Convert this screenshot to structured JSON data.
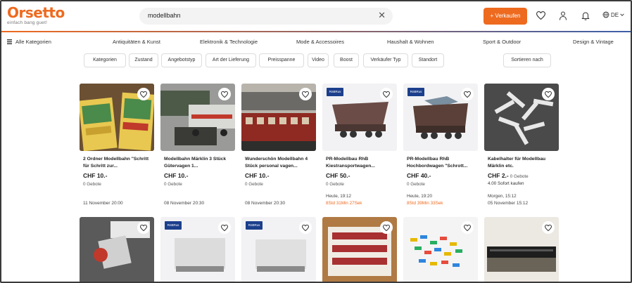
{
  "header": {
    "logo": "Orsetto",
    "tagline": "einfach bang guet!",
    "search_value": "modellbahn",
    "sell_label": "+ Verkaufen",
    "language": "DE"
  },
  "nav": {
    "all_categories": "Alle Kategorien",
    "categories": [
      "Antiquitäten & Kunst",
      "Elektronik & Technologie",
      "Mode & Accessoires",
      "Haushalt & Wohnen",
      "Sport & Outdoor",
      "Design & Vintage"
    ]
  },
  "filters": [
    "Kategorien",
    "Zustand",
    "Angebotstyp",
    "Art der Lieferung",
    "Preisspanne",
    "Video",
    "Boost",
    "Verkäufer Typ",
    "Standort"
  ],
  "sort_label": "Sortieren nach",
  "badge_label": "RnBRus",
  "listings": [
    {
      "title": "2 Ordner Modellbahn \"Schritt für Schritt zur...",
      "price": "CHF 10.-",
      "bids": "0 Gebote",
      "date": "11 November 20:00"
    },
    {
      "title": "Modellbahn Märklin 3 Stück Gütervagen 1...",
      "price": "CHF 10.-",
      "bids": "0 Gebote",
      "date": "08 November 20:30"
    },
    {
      "title": "Wunderschön Modellbahn 4 Stück personal vagen...",
      "price": "CHF 10.-",
      "bids": "0 Gebote",
      "date": "08 November 20:30"
    },
    {
      "title": "PR-Modellbau RhB Kiestransportwagen...",
      "price": "CHF 50.-",
      "bids": "0 Gebote",
      "date": "Heute, 19:12",
      "countdown": "8Std 31Min 27Sek"
    },
    {
      "title": "PR-Modellbau RhB Hochbordwagen \"Schrott...",
      "price": "CHF 40.-",
      "bids": "0 Gebote",
      "date": "Heute, 19:20",
      "countdown": "8Std 39Min 33Sek"
    },
    {
      "title": "Kabelhalter für Modellbau Märklin etc.",
      "price": "CHF 2.-",
      "price_note": "0 Gebote",
      "buy_now": "4.00  Sofort kaufen",
      "date": "Morgen, 15:12",
      "date2": "05 November 15:12"
    }
  ]
}
